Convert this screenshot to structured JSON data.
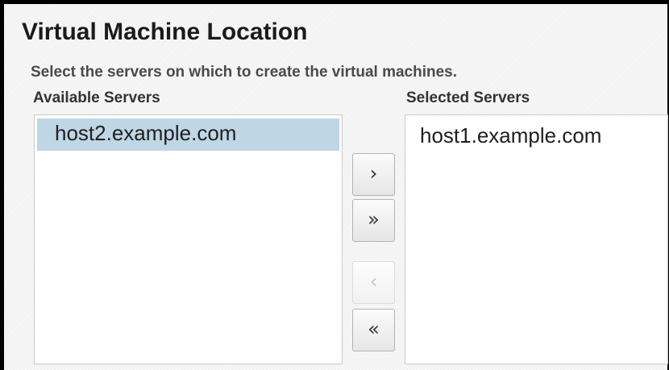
{
  "title": "Virtual Machine Location",
  "instruction": "Select the servers on which to create the virtual machines.",
  "available": {
    "label": "Available Servers",
    "items": [
      "host2.example.com"
    ]
  },
  "selected": {
    "label": "Selected Servers",
    "items": [
      "host1.example.com"
    ]
  },
  "shuttle_buttons": {
    "move": "›",
    "move_all": "»",
    "remove": "‹",
    "remove_all": "«"
  },
  "state": {
    "available_selected_index": 0,
    "remove_enabled": false
  }
}
